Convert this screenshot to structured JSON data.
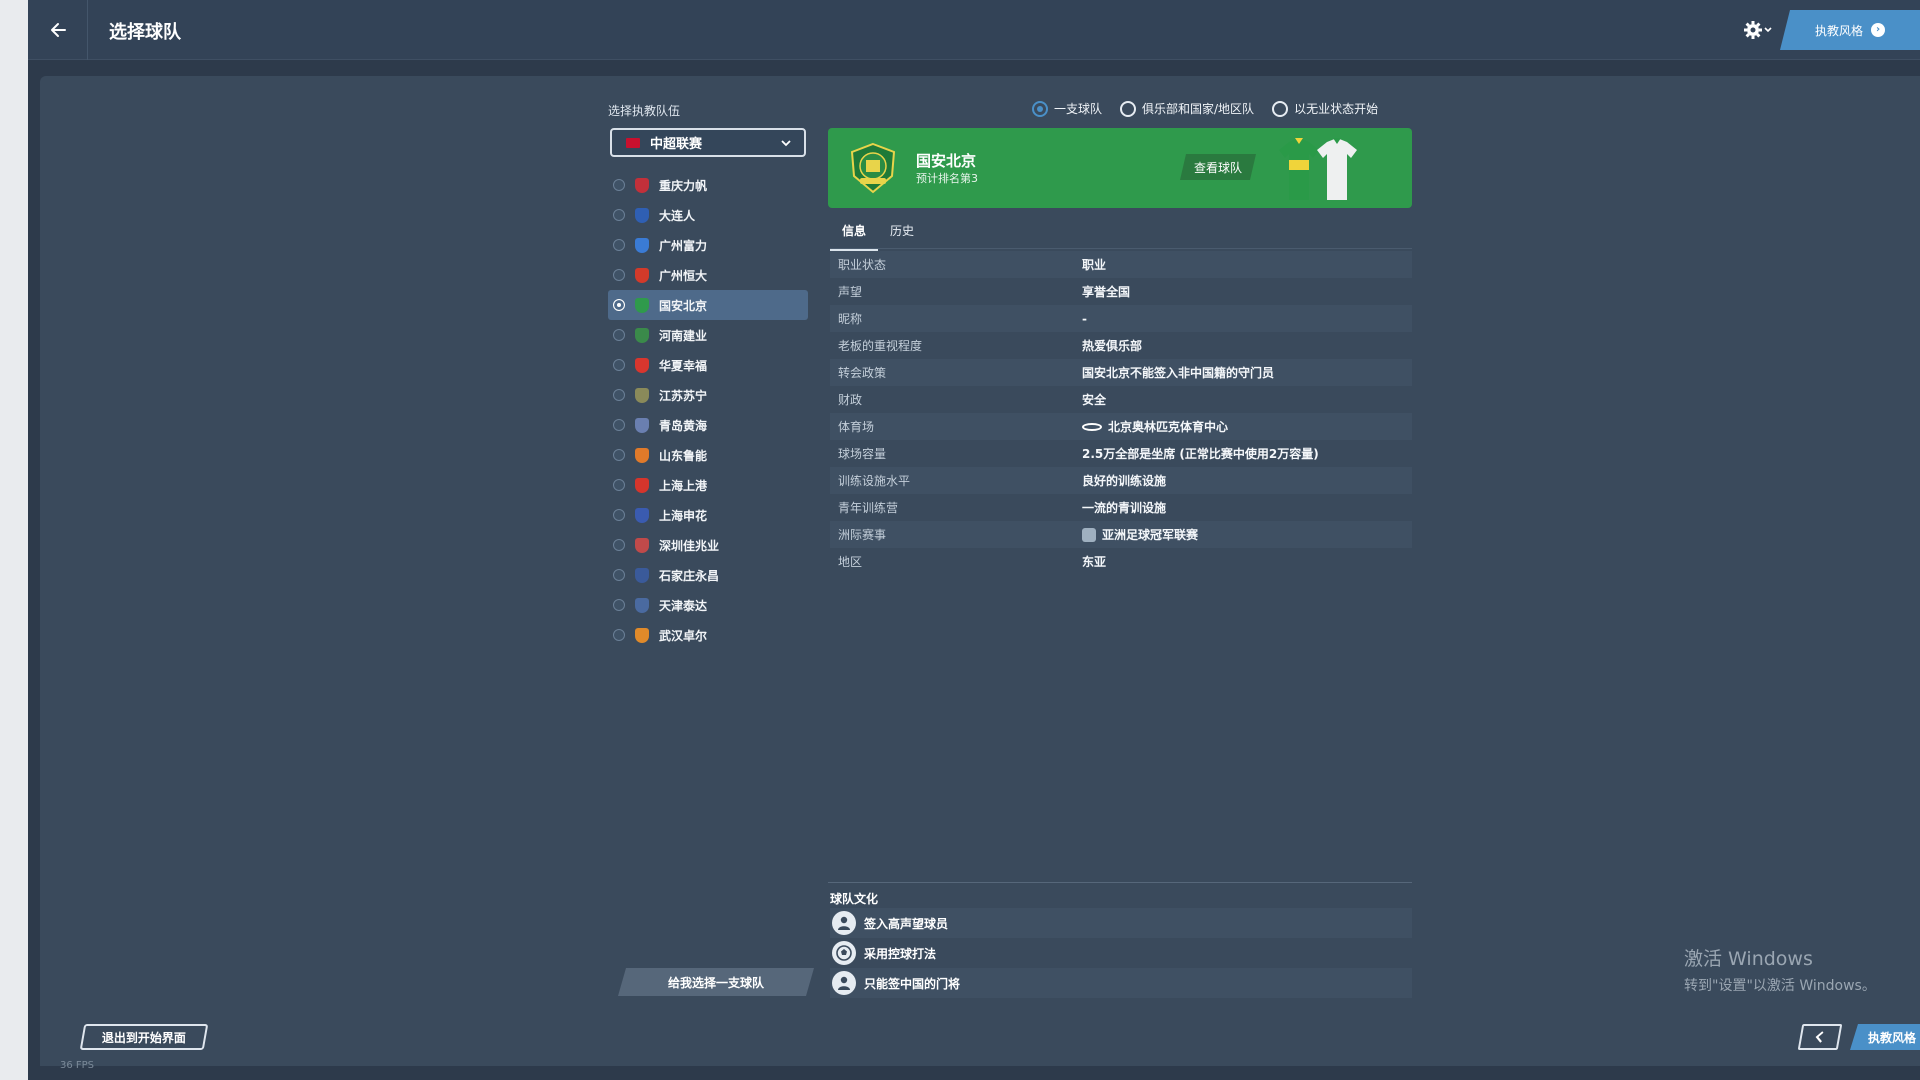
{
  "header": {
    "title": "选择球队",
    "style_button": "执教风格"
  },
  "left": {
    "select_label": "选择执教队伍",
    "league": "中超联赛",
    "teams": [
      {
        "name": "重庆力帆",
        "color": "#c2303a"
      },
      {
        "name": "大连人",
        "color": "#2f5fb3"
      },
      {
        "name": "广州富力",
        "color": "#3a7bd5"
      },
      {
        "name": "广州恒大",
        "color": "#d23a2a"
      },
      {
        "name": "国安北京",
        "color": "#2f9a4c"
      },
      {
        "name": "河南建业",
        "color": "#3a8a4a"
      },
      {
        "name": "华夏幸福",
        "color": "#d8362e"
      },
      {
        "name": "江苏苏宁",
        "color": "#8a8a5a"
      },
      {
        "name": "青岛黄海",
        "color": "#6a7fb0"
      },
      {
        "name": "山东鲁能",
        "color": "#e07a2a"
      },
      {
        "name": "上海上港",
        "color": "#d5352c"
      },
      {
        "name": "上海申花",
        "color": "#3a5bb0"
      },
      {
        "name": "深圳佳兆业",
        "color": "#c04a4a"
      },
      {
        "name": "石家庄永昌",
        "color": "#3a5a9a"
      },
      {
        "name": "天津泰达",
        "color": "#4a6aa0"
      },
      {
        "name": "武汉卓尔",
        "color": "#e08a2a"
      }
    ],
    "selected_index": 4,
    "random_button": "给我选择一支球队"
  },
  "mode": {
    "options": [
      "一支球队",
      "俱乐部和国家/地区队",
      "以无业状态开始"
    ],
    "selected": 0
  },
  "club": {
    "name": "国安北京",
    "subtitle": "预计排名第3",
    "view_button": "查看球队",
    "accent": "#2f9a4c"
  },
  "tabs": [
    "信息",
    "历史"
  ],
  "info": [
    {
      "k": "职业状态",
      "v": "职业"
    },
    {
      "k": "声望",
      "v": "享誉全国"
    },
    {
      "k": "昵称",
      "v": "-"
    },
    {
      "k": "老板的重视程度",
      "v": "热爱俱乐部"
    },
    {
      "k": "转会政策",
      "v": "国安北京不能签入非中国籍的守门员"
    },
    {
      "k": "财政",
      "v": "安全"
    },
    {
      "k": "体育场",
      "v": "北京奥林匹克体育中心",
      "icon": "stadium-icon"
    },
    {
      "k": "球场容量",
      "v": "2.5万全部是坐席 (正常比赛中使用2万容量)"
    },
    {
      "k": "训练设施水平",
      "v": "良好的训练设施"
    },
    {
      "k": "青年训练营",
      "v": "一流的青训设施"
    },
    {
      "k": "洲际赛事",
      "v": "亚洲足球冠军联赛",
      "icon": "afc-trophy-icon"
    },
    {
      "k": "地区",
      "v": "东亚"
    }
  ],
  "culture": {
    "title": "球队文化",
    "items": [
      {
        "label": "签入高声望球员",
        "icon": "player-icon"
      },
      {
        "label": "采用控球打法",
        "icon": "ball-icon"
      },
      {
        "label": "只能签中国的门将",
        "icon": "player-icon"
      }
    ]
  },
  "footer": {
    "exit": "退出到开始界面",
    "fps": "36 FPS",
    "next": "执教风格"
  },
  "watermark": {
    "line1": "激活 Windows",
    "line2": "转到\"设置\"以激活 Windows。"
  }
}
